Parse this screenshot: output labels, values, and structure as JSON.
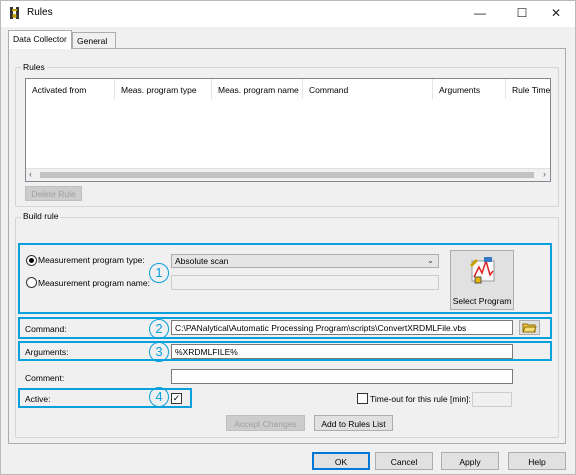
{
  "window": {
    "title": "Rules"
  },
  "tabs": [
    {
      "label": "Data Collector",
      "active": true
    },
    {
      "label": "General",
      "active": false
    }
  ],
  "rules_group": {
    "label": "Rules",
    "columns": [
      "Activated from",
      "Meas. program type",
      "Meas. program name",
      "Command",
      "Arguments",
      "Rule Timeo"
    ],
    "delete_label": "Delete Rule"
  },
  "build_rule": {
    "label": "Build rule",
    "radio_type_label": "Measurement program type:",
    "radio_name_label": "Measurement program name:",
    "type_value": "Absolute scan",
    "name_value": "",
    "select_program_label": "Select Program",
    "command_label": "Command:",
    "command_value": "C:\\PANalytical\\Automatic Processing Program\\scripts\\ConvertXRDMLFile.vbs",
    "arguments_label": "Arguments:",
    "arguments_value": "%XRDMLFILE%",
    "comment_label": "Comment:",
    "comment_value": "",
    "active_label": "Active:",
    "active_checked": true,
    "timeout_label": "Time-out for this rule [min]:",
    "timeout_value": "",
    "accept_label": "Accept Changes",
    "add_label": "Add to Rules List"
  },
  "callouts": [
    "1",
    "2",
    "3",
    "4"
  ],
  "footer": {
    "ok": "OK",
    "cancel": "Cancel",
    "apply": "Apply",
    "help": "Help"
  },
  "colors": {
    "callout": "#0aa0dc",
    "default_button": "#0078d7"
  }
}
